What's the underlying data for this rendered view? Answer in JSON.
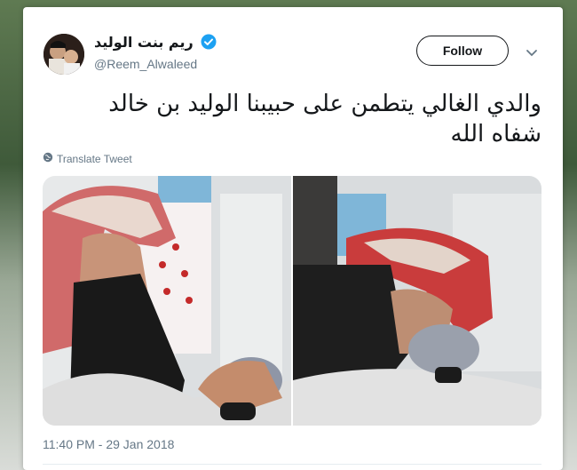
{
  "tweet": {
    "display_name": "ريم بنت الوليد",
    "handle": "@Reem_Alwaleed",
    "verified": true,
    "follow_label": "Follow",
    "text_line1": "والدي الغالي يتطمن على حبيبنا الوليد بن خالد",
    "text_line2": "شفاه الله",
    "translate_label": "Translate Tweet",
    "timestamp": "11:40 PM - 29 Jan 2018"
  },
  "icons": {
    "verified": "verified-badge-icon",
    "caret": "chevron-down-icon",
    "globe": "globe-icon"
  },
  "colors": {
    "verified_blue": "#1da1f2",
    "text": "#14171a",
    "muted": "#657786"
  }
}
